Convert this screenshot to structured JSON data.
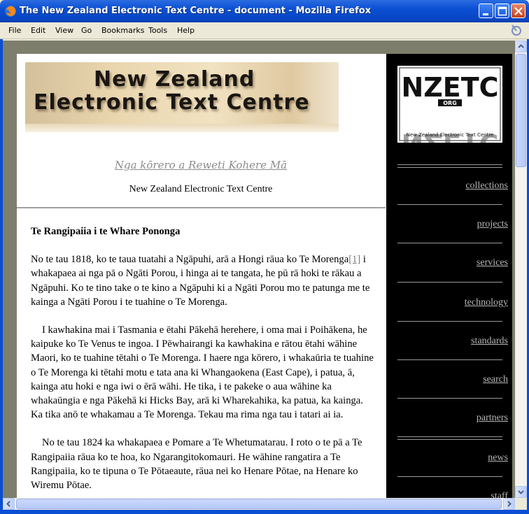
{
  "window": {
    "title": "The New Zealand Electronic Text Centre - document - Mozilla Firefox"
  },
  "menu": [
    "File",
    "Edit",
    "View",
    "Go",
    "Bookmarks",
    "Tools",
    "Help"
  ],
  "banner": {
    "line1": "New Zealand",
    "line2": "Electronic Text Centre"
  },
  "header": {
    "maori_title": "Nga kōrero a Reweti Kohere Mā",
    "site_name": "New Zealand Electronic Text Centre"
  },
  "logo": {
    "top_text": "NZETC",
    "org_text": "ORG",
    "caption": "New Zealand Electronic Text Centre"
  },
  "document": {
    "heading": "Te Rangipaiia i te Whare Pononga",
    "p1_before": "No te tau 1818, ko te taua tuatahi a Ngāpuhi, arā a Hongi rāua ko Te Morenga",
    "p1_fn": "[1]",
    "p1_after": " i whakapaea ai nga pā o Ngāti Porou, i hinga ai te tangata, he pū rā hoki te rākau a Ngāpuhi. Ko te tino take o te kino a Ngāpuhi ki a Ngāti Porou mo te patunga me te kainga a Ngāti Porou i te tuahine o Te Morenga.",
    "p2": "I kawhakina mai i Tasmania e ētahi Pākehā herehere, i oma mai i Poihākena, he kaipuke ko Te Venus te ingoa. I Pēwhairangi ka kawhakina e rātou ētahi wāhine Maori, ko te tuahine tētahi o Te Morenga. I haere nga kōrero, i whakaūria te tuahine o Te Morenga ki tētahi motu e tata ana ki Whangaokena (East Cape), i patua, ā, kainga atu hoki e nga iwi o ērā wāhi. He tika, i te pakeke o aua wāhine ka whakaūngia e nga Pākehā ki Hicks Bay, arā ki Wharekahika, ka patua, ka kainga. Ka tika anō te whakamau a Te Morenga. Tekau ma rima nga tau i tatari ai ia.",
    "p3": "No te tau 1824 ka whakapaea e Pomare a Te Whetumatarau. I roto o te pā a Te Rangipaiia rāua ko te hoa, ko Ngarangitokomauri. He wāhine rangatira a Te Rangipaiia, ko te tipuna o Te Pōtaeaute, rāua nei ko Henare Pōtae, na Henare ko Wiremu Pōtae."
  },
  "nav": [
    "collections",
    "projects",
    "services",
    "technology",
    "standards",
    "search",
    "partners",
    "news",
    "staff"
  ]
}
